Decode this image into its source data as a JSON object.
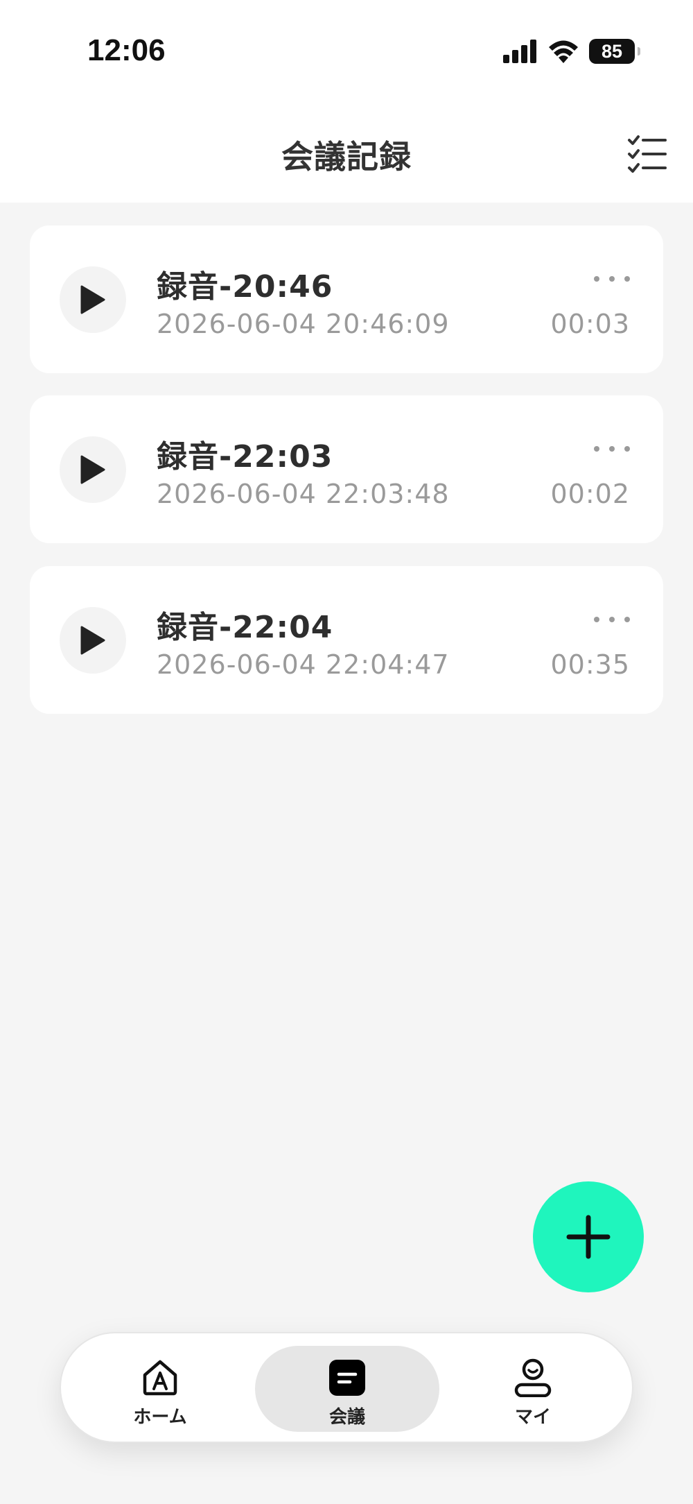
{
  "status_bar": {
    "time": "12:06",
    "battery": "85"
  },
  "header": {
    "title": "会議記録",
    "checklist_icon": "checklist-icon"
  },
  "recordings": [
    {
      "title": "録音-20:46",
      "datetime": "2026-06-04 20:46:09",
      "duration": "00:03"
    },
    {
      "title": "録音-22:03",
      "datetime": "2026-06-04 22:03:48",
      "duration": "00:02"
    },
    {
      "title": "録音-22:04",
      "datetime": "2026-06-04 22:04:47",
      "duration": "00:35"
    }
  ],
  "fab": {
    "icon": "plus-icon",
    "color": "#1ff5bd"
  },
  "tabbar": {
    "tabs": [
      {
        "label": "ホーム",
        "icon": "home-a-icon",
        "active": false
      },
      {
        "label": "会議",
        "icon": "meeting-note-icon",
        "active": true
      },
      {
        "label": "マイ",
        "icon": "user-icon",
        "active": false
      }
    ]
  }
}
